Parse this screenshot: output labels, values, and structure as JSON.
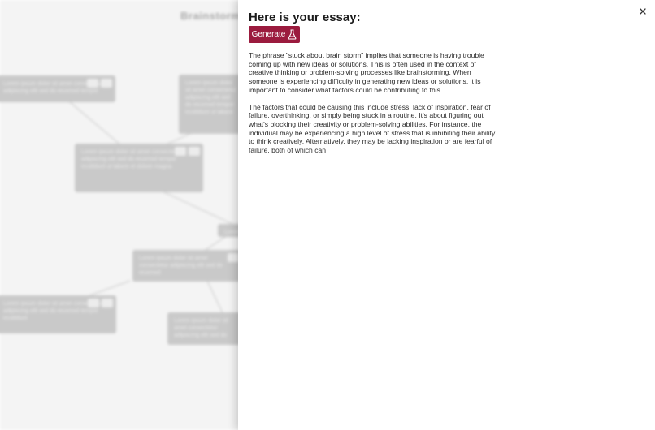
{
  "background": {
    "title": "Brainstorm",
    "nodes": [
      {
        "id": "n1",
        "text": "Lorem ipsum dolor sit amet consectetur adipiscing elit sed do eiusmod tempor"
      },
      {
        "id": "n2",
        "text": "Lorem ipsum dolor sit amet consectetur adipiscing elit sed do eiusmod tempor incididunt ut labore"
      },
      {
        "id": "n3",
        "text": "Lorem ipsum dolor sit amet consectetur adipiscing elit sed do eiusmod tempor incididunt ut labore et dolore magna"
      },
      {
        "id": "n4",
        "text": "Lorem ipsum"
      },
      {
        "id": "n5",
        "text": "Lorem ipsum dolor sit amet consectetur adipiscing elit sed do eiusmod"
      },
      {
        "id": "n6",
        "text": "Lorem ipsum dolor sit amet consectetur adipiscing elit sed do eiusmod tempor incididunt"
      },
      {
        "id": "n7",
        "text": "Lorem ipsum dolor sit amet consectetur adipiscing elit sed do"
      }
    ]
  },
  "drawer": {
    "title": "Here is your essay:",
    "generate_label": "Generate",
    "generate_icon": "flask-icon",
    "close_icon": "close-icon",
    "accent_color": "#9b1b3e",
    "paragraphs": [
      "The phrase \"stuck about brain storm\" implies that someone is having trouble coming up with new ideas or solutions. This is often used in the context of creative thinking or problem-solving processes like brainstorming. When someone is experiencing difficulty in generating new ideas or solutions, it is important to consider what factors could be contributing to this.",
      "The factors that could be causing this include stress, lack of inspiration, fear of failure, overthinking, or simply being stuck in a routine. It's about figuring out what's blocking their creativity or problem-solving abilities. For instance, the individual may be experiencing a high level of stress that is inhibiting their ability to think creatively. Alternatively, they may be lacking inspiration or are fearful of failure, both of which can"
    ]
  }
}
